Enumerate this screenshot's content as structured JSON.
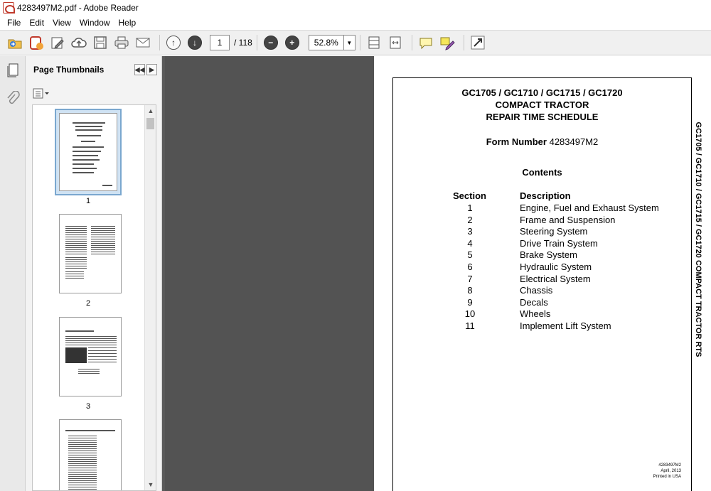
{
  "window": {
    "title": "4283497M2.pdf - Adobe Reader"
  },
  "menu": [
    "File",
    "Edit",
    "View",
    "Window",
    "Help"
  ],
  "toolbar": {
    "current_page": "1",
    "page_count": "/ 118",
    "zoom": "52.8%"
  },
  "thumbnails": {
    "header": "Page Thumbnails",
    "pages": [
      "1",
      "2",
      "3"
    ]
  },
  "document": {
    "title_lines": [
      "GC1705 / GC1710 / GC1715 / GC1720",
      "COMPACT  TRACTOR",
      "REPAIR TIME SCHEDULE"
    ],
    "form_label": "Form Number",
    "form_number": "4283497M2",
    "contents_heading": "Contents",
    "section_header": "Section",
    "description_header": "Description",
    "sections": [
      {
        "num": "1",
        "desc": "Engine, Fuel and Exhaust System"
      },
      {
        "num": "2",
        "desc": "Frame and Suspension"
      },
      {
        "num": "3",
        "desc": "Steering System"
      },
      {
        "num": "4",
        "desc": "Drive Train System"
      },
      {
        "num": "5",
        "desc": "Brake System"
      },
      {
        "num": "6",
        "desc": "Hydraulic System"
      },
      {
        "num": "7",
        "desc": "Electrical System"
      },
      {
        "num": "8",
        "desc": "Chassis"
      },
      {
        "num": "9",
        "desc": "Decals"
      },
      {
        "num": "10",
        "desc": "Wheels"
      },
      {
        "num": "11",
        "desc": "Implement Lift System"
      }
    ],
    "side_text": "GC1705 / GC1710 / GC1715 / GC1720 COMPACT TRACTOR RTS",
    "footer": [
      "4283497M2",
      "April, 2013",
      "Printed in USA"
    ]
  }
}
